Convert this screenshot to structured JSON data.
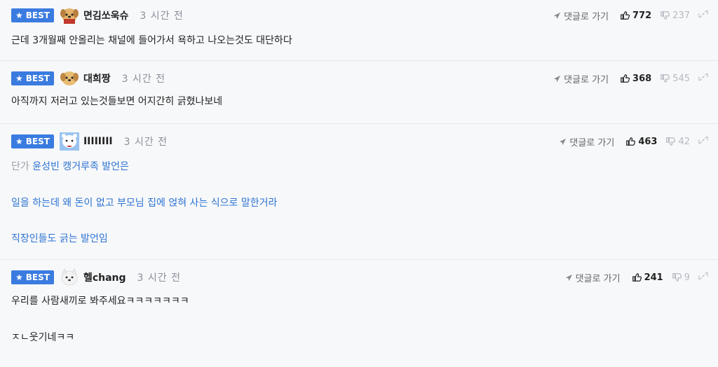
{
  "comments": [
    {
      "badge": "BEST",
      "nickname": "면김쏘욱슈",
      "time": "3 시간 전",
      "reply_label": "댓글로 가기",
      "likes": "772",
      "dislikes": "237",
      "lines": [
        "근데 3개월째 안올리는 채널에 들어가서 욕하고 나오는것도 대단하다"
      ]
    },
    {
      "badge": "BEST",
      "nickname": "대희짱",
      "time": "3 시간 전",
      "reply_label": "댓글로 가기",
      "likes": "368",
      "dislikes": "545",
      "lines": [
        "아직까지 저러고 있는것들보면 어지간히 긁혔나보네"
      ]
    },
    {
      "badge": "BEST",
      "nickname": "IIIIIIII",
      "time": "3 시간 전",
      "reply_label": "댓글로 가기",
      "likes": "463",
      "dislikes": "42",
      "quote_prefix": "단가",
      "lines": [
        "윤성빈 캥거루족 발언은",
        "일을 하는데 왜 돈이 없고 부모님 집에 얹혀 사는 식으로 말한거라",
        "직장인들도 긁는 발언임"
      ]
    },
    {
      "badge": "BEST",
      "nickname": "헬chang",
      "time": "3 시간 전",
      "reply_label": "댓글로 가기",
      "likes": "241",
      "dislikes": "9",
      "lines": [
        "우리를 사람새끼로 봐주세요ㅋㅋㅋㅋㅋㅋㅋ",
        "ㅈㄴ웃기네ㅋㅋ"
      ]
    }
  ],
  "icons": {
    "badge_star": "star-icon",
    "reply": "arrow-icon",
    "like": "thumbs-up-icon",
    "dislike": "thumbs-down-icon",
    "share": "link-icon"
  },
  "colors": {
    "badge": "#3a7be0",
    "link_text": "#2d73d1",
    "muted": "#8a8f98",
    "background": "#f7f8fa"
  }
}
